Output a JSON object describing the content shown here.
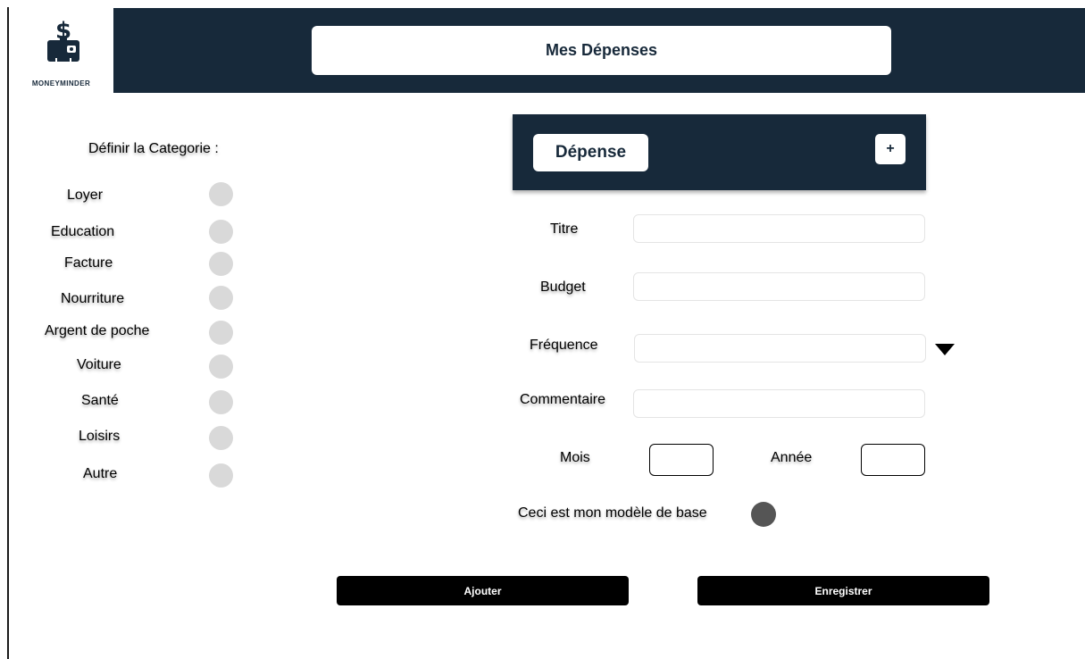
{
  "app": {
    "logo_text": "MONEYMINDER",
    "page_title": "Mes Dépenses"
  },
  "categories": {
    "title": "Définir la Categorie :",
    "items": [
      {
        "label": "Loyer"
      },
      {
        "label": "Education"
      },
      {
        "label": "Facture"
      },
      {
        "label": "Nourriture"
      },
      {
        "label": "Argent de poche"
      },
      {
        "label": "Voiture"
      },
      {
        "label": "Santé"
      },
      {
        "label": "Loisirs"
      },
      {
        "label": "Autre"
      }
    ]
  },
  "form": {
    "tab_label": "Dépense",
    "add_label": "+",
    "fields": {
      "titre": {
        "label": "Titre",
        "value": ""
      },
      "budget": {
        "label": "Budget",
        "value": ""
      },
      "frequence": {
        "label": "Fréquence",
        "value": ""
      },
      "commentaire": {
        "label": "Commentaire",
        "value": ""
      }
    },
    "mois": {
      "label": "Mois",
      "value": ""
    },
    "annee": {
      "label": "Année",
      "value": ""
    },
    "base_model_label": "Ceci est mon modèle de base"
  },
  "buttons": {
    "add": "Ajouter",
    "save": "Enregistrer"
  },
  "colors": {
    "header": "#17293a",
    "radio_idle": "#d9d9d9",
    "radio_base": "#555555",
    "button": "#000000"
  }
}
